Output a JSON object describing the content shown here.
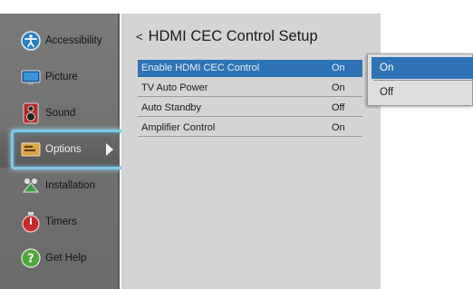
{
  "sidebar": {
    "items": [
      {
        "label": "Accessibility",
        "icon": "accessibility-icon"
      },
      {
        "label": "Picture",
        "icon": "picture-icon"
      },
      {
        "label": "Sound",
        "icon": "speaker-icon"
      },
      {
        "label": "Options",
        "icon": "options-icon"
      },
      {
        "label": "Installation",
        "icon": "installation-icon"
      },
      {
        "label": "Timers",
        "icon": "timer-icon"
      },
      {
        "label": "Get Help",
        "icon": "help-icon"
      }
    ],
    "selected": "Options"
  },
  "main": {
    "back_glyph": "<",
    "title": "HDMI CEC Control Setup",
    "rows": [
      {
        "name": "Enable HDMI CEC Control",
        "value": "On"
      },
      {
        "name": "TV Auto Power",
        "value": "On"
      },
      {
        "name": "Auto Standby",
        "value": "Off"
      },
      {
        "name": "Amplifier Control",
        "value": "On"
      }
    ]
  },
  "dropdown": {
    "options": [
      "On",
      "Off"
    ],
    "selected": "On"
  },
  "colors": {
    "highlight": "#2d73b5",
    "selection_glow": "#7ec9e6",
    "sidebar_bg": "#707070",
    "panel_bg": "#d4d4d4"
  }
}
